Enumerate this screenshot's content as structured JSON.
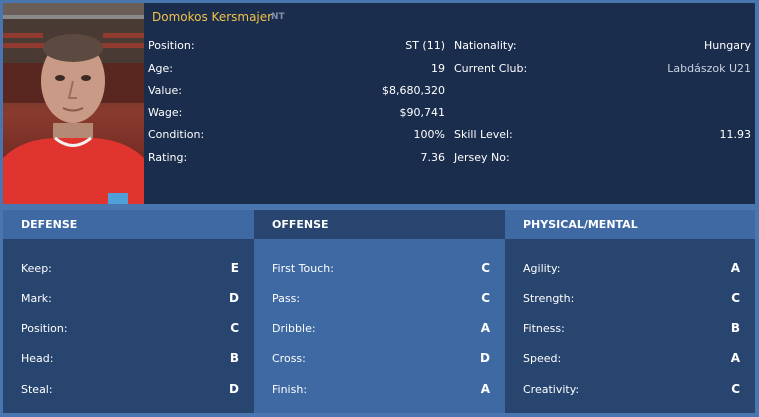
{
  "player": {
    "name": "Domokos Kersmajer",
    "badge": "NT"
  },
  "info_left": [
    {
      "label": "Position:",
      "value": "ST (11)"
    },
    {
      "label": "Age:",
      "value": "19"
    },
    {
      "label": "Value:",
      "value": "$8,680,320"
    },
    {
      "label": "Wage:",
      "value": "$90,741"
    },
    {
      "label": "Condition:",
      "value": "100%"
    },
    {
      "label": "Rating:",
      "value": "7.36"
    }
  ],
  "info_right": [
    {
      "label": "Nationality:",
      "value": "Hungary"
    },
    {
      "label": "Current Club:",
      "value": "Labdászok U21"
    },
    {
      "label": "Skill Level:",
      "value": "11.93"
    },
    {
      "label": "Jersey No:",
      "value": ""
    }
  ],
  "panels": {
    "defense": {
      "title": "DEFENSE",
      "attrs": [
        {
          "label": "Keep:",
          "grade": "E"
        },
        {
          "label": "Mark:",
          "grade": "D"
        },
        {
          "label": "Position:",
          "grade": "C"
        },
        {
          "label": "Head:",
          "grade": "B"
        },
        {
          "label": "Steal:",
          "grade": "D"
        }
      ]
    },
    "offense": {
      "title": "OFFENSE",
      "attrs": [
        {
          "label": "First Touch:",
          "grade": "C"
        },
        {
          "label": "Pass:",
          "grade": "C"
        },
        {
          "label": "Dribble:",
          "grade": "A"
        },
        {
          "label": "Cross:",
          "grade": "D"
        },
        {
          "label": "Finish:",
          "grade": "A"
        }
      ]
    },
    "physical": {
      "title": "PHYSICAL/MENTAL",
      "attrs": [
        {
          "label": "Agility:",
          "grade": "A"
        },
        {
          "label": "Strength:",
          "grade": "C"
        },
        {
          "label": "Fitness:",
          "grade": "B"
        },
        {
          "label": "Speed:",
          "grade": "A"
        },
        {
          "label": "Creativity:",
          "grade": "C"
        }
      ]
    }
  },
  "colors": {
    "accent_name": "#f2c24a",
    "panel_dark": "#27456f",
    "panel_light": "#3f69a3",
    "header_bg": "#1a2d4d"
  }
}
